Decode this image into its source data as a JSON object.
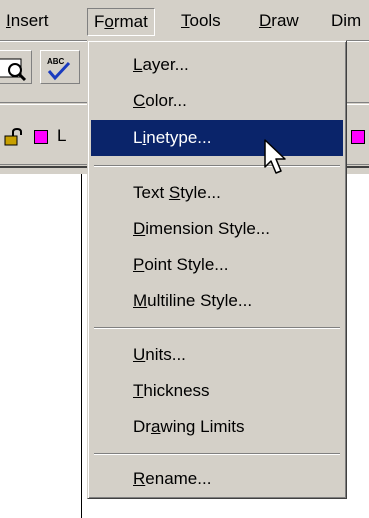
{
  "menubar": {
    "items": [
      {
        "pre": "",
        "key": "I",
        "post": "nsert"
      },
      {
        "pre": "F",
        "key": "o",
        "post": "rmat"
      },
      {
        "pre": "",
        "key": "T",
        "post": "ools"
      },
      {
        "pre": "",
        "key": "D",
        "post": "raw"
      },
      {
        "pre": "Dim",
        "key": "",
        "post": ""
      }
    ]
  },
  "toolbar": {
    "spell_icon_text": "ABC"
  },
  "layer": {
    "name_fragment": "L"
  },
  "format_menu": {
    "items": [
      {
        "pre": "",
        "key": "L",
        "post": "ayer..."
      },
      {
        "pre": "",
        "key": "C",
        "post": "olor..."
      },
      {
        "pre": "L",
        "key": "i",
        "post": "netype..."
      },
      {
        "pre": "Text ",
        "key": "S",
        "post": "tyle..."
      },
      {
        "pre": "",
        "key": "D",
        "post": "imension Style..."
      },
      {
        "pre": "",
        "key": "P",
        "post": "oint Style..."
      },
      {
        "pre": "",
        "key": "M",
        "post": "ultiline Style..."
      },
      {
        "pre": "",
        "key": "U",
        "post": "nits..."
      },
      {
        "pre": "",
        "key": "T",
        "post": "hickness"
      },
      {
        "pre": "Dr",
        "key": "a",
        "post": "wing Limits"
      },
      {
        "pre": "",
        "key": "R",
        "post": "ename..."
      }
    ],
    "highlighted_index": 2
  },
  "colors": {
    "chrome": "#d4d0c8",
    "highlight": "#0a246a",
    "layer_swatch": "#ff00ff"
  }
}
